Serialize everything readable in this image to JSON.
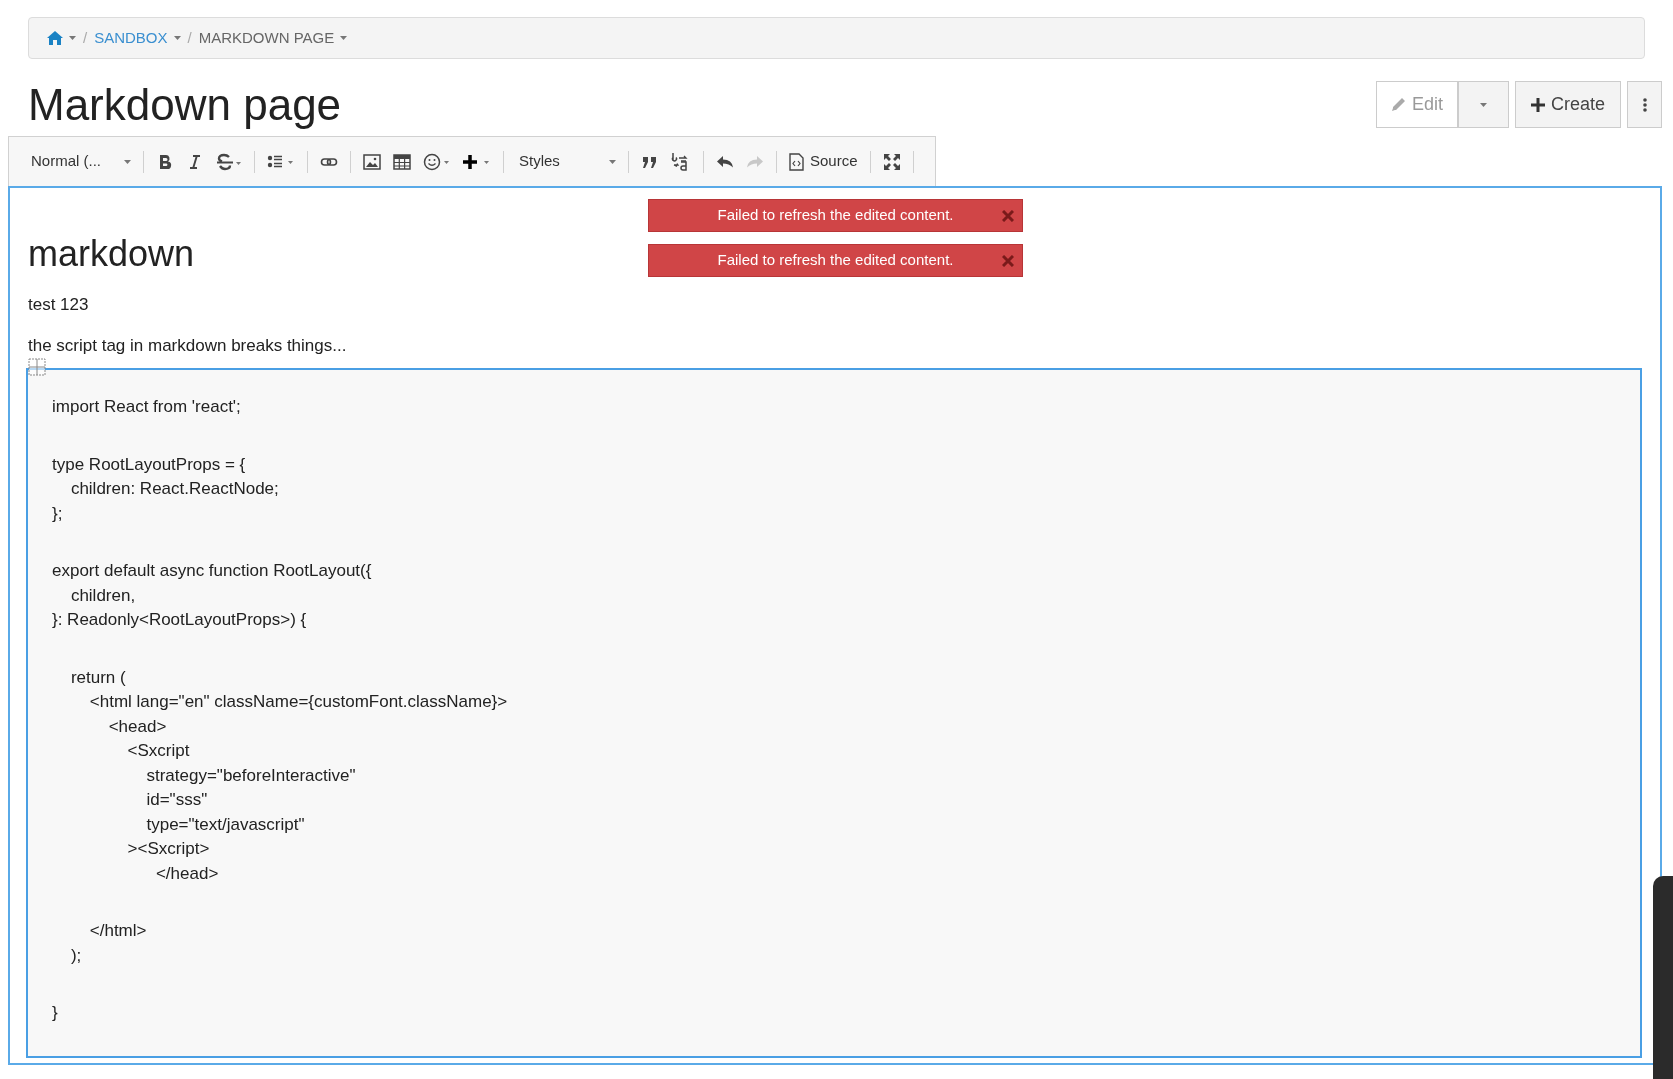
{
  "breadcrumb": [
    {
      "kind": "home"
    },
    {
      "kind": "sep",
      "label": "/"
    },
    {
      "kind": "link",
      "label": "SANDBOX"
    },
    {
      "kind": "sep",
      "label": "/"
    },
    {
      "kind": "current",
      "label": "MARKDOWN PAGE"
    }
  ],
  "title": "Markdown page",
  "actions": [
    {
      "kind": "edit",
      "label": "Edit"
    },
    {
      "kind": "caret"
    },
    {
      "kind": "create",
      "label": "Create"
    },
    {
      "kind": "more"
    }
  ],
  "toolbar": [
    {
      "kind": "format",
      "label": "Normal (..."
    },
    {
      "kind": "sep"
    },
    {
      "kind": "bold"
    },
    {
      "kind": "italic"
    },
    {
      "kind": "strike"
    },
    {
      "kind": "sep"
    },
    {
      "kind": "list"
    },
    {
      "kind": "sep"
    },
    {
      "kind": "link"
    },
    {
      "kind": "sep"
    },
    {
      "kind": "image"
    },
    {
      "kind": "table"
    },
    {
      "kind": "emoji"
    },
    {
      "kind": "plus"
    },
    {
      "kind": "sep"
    },
    {
      "kind": "styles",
      "label": "Styles"
    },
    {
      "kind": "sep"
    },
    {
      "kind": "quote"
    },
    {
      "kind": "ba"
    },
    {
      "kind": "sep"
    },
    {
      "kind": "undo",
      "disabled": false
    },
    {
      "kind": "redo",
      "disabled": true
    },
    {
      "kind": "sep"
    },
    {
      "kind": "source",
      "label": "Source"
    },
    {
      "kind": "sep"
    },
    {
      "kind": "fullscreen"
    },
    {
      "kind": "sep"
    }
  ],
  "alerts": [
    "Failed to refresh the edited content.",
    "Failed to refresh the edited content."
  ],
  "content": {
    "heading": "markdown",
    "paragraphs": [
      "test 123",
      "the script tag in markdown breaks things..."
    ],
    "code_blocks": [
      [
        "import React from 'react';"
      ],
      [
        "type RootLayoutProps = {",
        "    children: React.ReactNode;",
        "};"
      ],
      [
        "export default async function RootLayout({",
        "    children,",
        "}: Readonly<RootLayoutProps>) {"
      ],
      [
        "    return (",
        "        <html lang=\"en\" className={customFont.className}>",
        "            <head>",
        "                <Sxcript",
        "                    strategy=\"beforeInteractive\"",
        "                    id=\"sss\"",
        "                    type=\"text/javascript\"",
        "                ><Sxcript>",
        "                      </head>"
      ],
      [
        "        </html>",
        "    );"
      ],
      [
        "}"
      ]
    ]
  }
}
